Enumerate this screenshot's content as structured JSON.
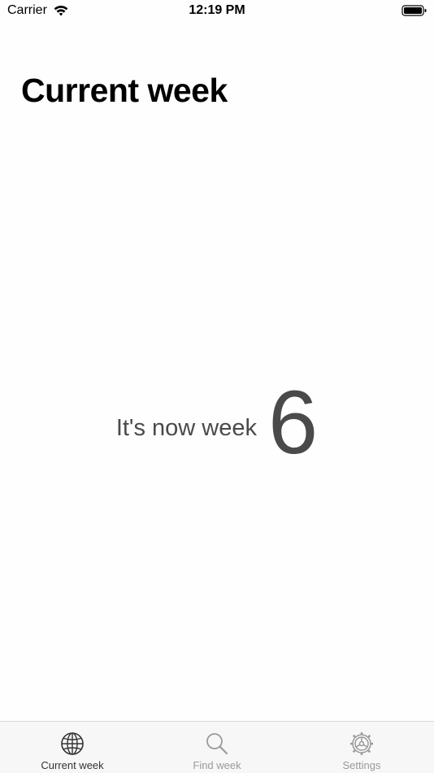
{
  "status_bar": {
    "carrier": "Carrier",
    "time": "12:19 PM",
    "wifi_icon": "wifi-icon",
    "battery_icon": "battery-icon"
  },
  "header": {
    "title": "Current week"
  },
  "main": {
    "label": "It's now week",
    "week_number": "6"
  },
  "tab_bar": {
    "tabs": [
      {
        "label": "Current week",
        "icon": "globe-icon",
        "active": true
      },
      {
        "label": "Find week",
        "icon": "search-icon",
        "active": false
      },
      {
        "label": "Settings",
        "icon": "gear-icon",
        "active": false
      }
    ]
  },
  "colors": {
    "active_tab": "#333333",
    "inactive_tab": "#9a9a9a",
    "week_text": "#4a4a4a"
  }
}
